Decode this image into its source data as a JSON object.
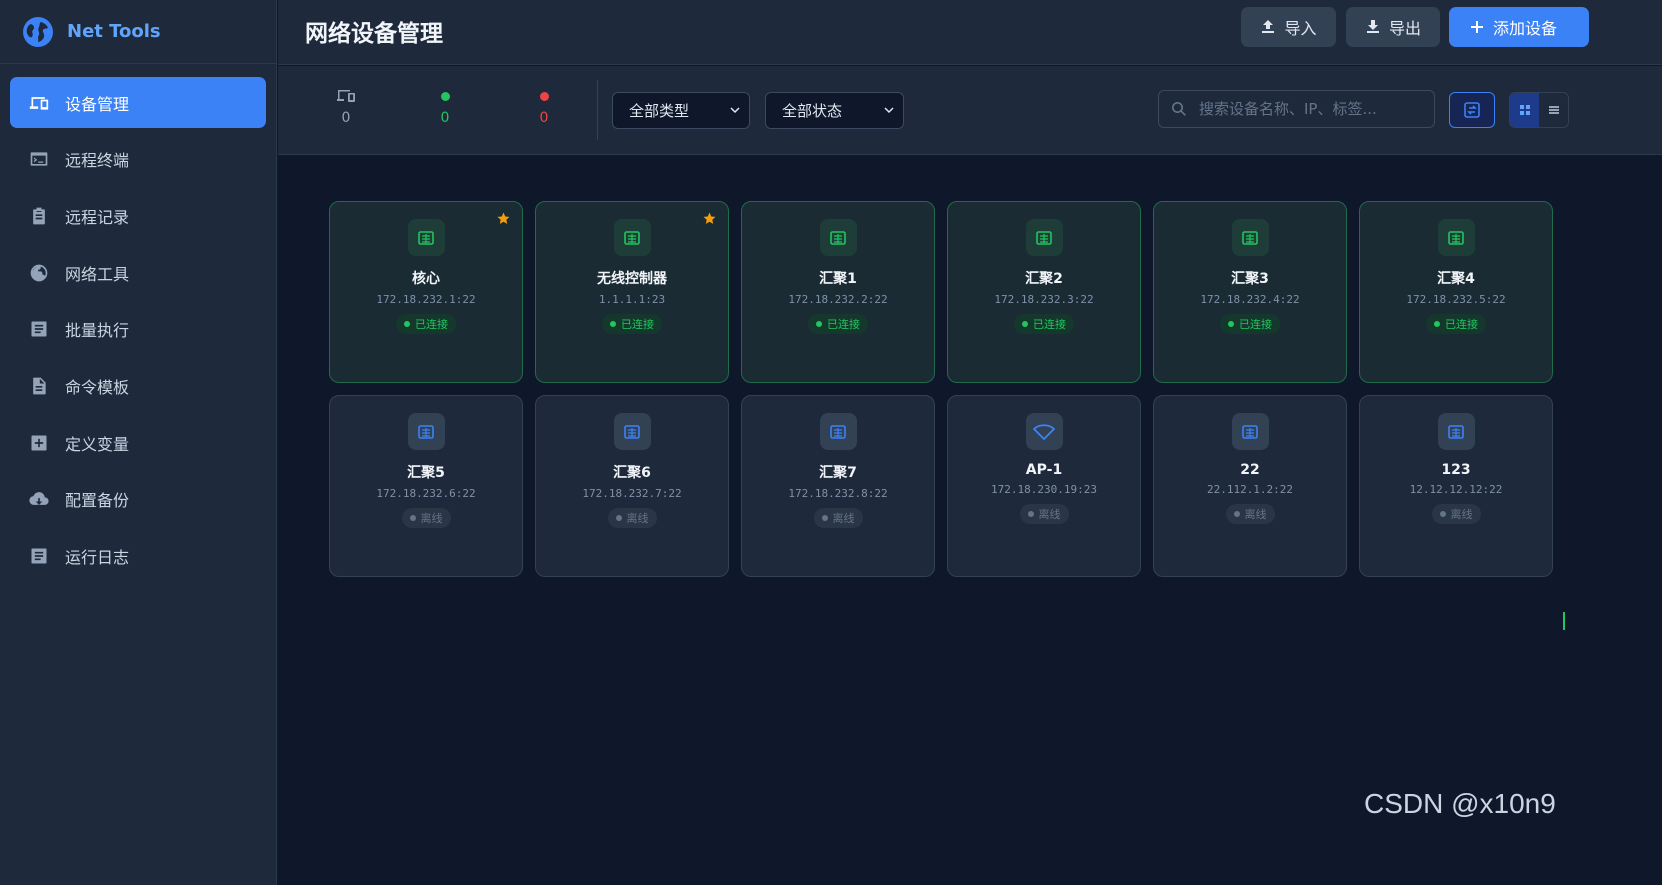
{
  "app": {
    "name": "Net Tools"
  },
  "sidebar": {
    "items": [
      {
        "label": "设备管理",
        "icon": "devices-icon",
        "active": true
      },
      {
        "label": "远程终端",
        "icon": "terminal-icon"
      },
      {
        "label": "远程记录",
        "icon": "clipboard-icon"
      },
      {
        "label": "网络工具",
        "icon": "globe-icon"
      },
      {
        "label": "批量执行",
        "icon": "document-icon"
      },
      {
        "label": "命令模板",
        "icon": "file-icon"
      },
      {
        "label": "定义变量",
        "icon": "plus-box-icon"
      },
      {
        "label": "配置备份",
        "icon": "cloud-download-icon"
      },
      {
        "label": "运行日志",
        "icon": "log-icon"
      }
    ]
  },
  "header": {
    "title": "网络设备管理",
    "import_label": "导入",
    "export_label": "导出",
    "add_label": "添加设备"
  },
  "toolbar": {
    "stats": {
      "total": "0",
      "online": "0",
      "offline": "0"
    },
    "type_filter": {
      "selected": "全部类型"
    },
    "status_filter": {
      "selected": "全部状态"
    },
    "search_placeholder": "搜索设备名称、IP、标签..."
  },
  "colors": {
    "accent": "#3b82f6",
    "online": "#22c55e",
    "offline": "#ef4444",
    "star": "#f59e0b"
  },
  "devices": [
    {
      "name": "核心",
      "address": "172.18.232.1:22",
      "status": "已连接",
      "online": true,
      "favorite": true,
      "icon": "switch-icon"
    },
    {
      "name": "无线控制器",
      "address": "1.1.1.1:23",
      "status": "已连接",
      "online": true,
      "favorite": true,
      "icon": "switch-icon"
    },
    {
      "name": "汇聚1",
      "address": "172.18.232.2:22",
      "status": "已连接",
      "online": true,
      "favorite": false,
      "icon": "switch-icon"
    },
    {
      "name": "汇聚2",
      "address": "172.18.232.3:22",
      "status": "已连接",
      "online": true,
      "favorite": false,
      "icon": "switch-icon"
    },
    {
      "name": "汇聚3",
      "address": "172.18.232.4:22",
      "status": "已连接",
      "online": true,
      "favorite": false,
      "icon": "switch-icon"
    },
    {
      "name": "汇聚4",
      "address": "172.18.232.5:22",
      "status": "已连接",
      "online": true,
      "favorite": false,
      "icon": "switch-icon"
    },
    {
      "name": "汇聚5",
      "address": "172.18.232.6:22",
      "status": "离线",
      "online": false,
      "favorite": false,
      "icon": "switch-icon"
    },
    {
      "name": "汇聚6",
      "address": "172.18.232.7:22",
      "status": "离线",
      "online": false,
      "favorite": false,
      "icon": "switch-icon"
    },
    {
      "name": "汇聚7",
      "address": "172.18.232.8:22",
      "status": "离线",
      "online": false,
      "favorite": false,
      "icon": "switch-icon"
    },
    {
      "name": "AP-1",
      "address": "172.18.230.19:23",
      "status": "离线",
      "online": false,
      "favorite": false,
      "icon": "wifi-icon"
    },
    {
      "name": "22",
      "address": "22.112.1.2:22",
      "status": "离线",
      "online": false,
      "favorite": false,
      "icon": "switch-icon"
    },
    {
      "name": "123",
      "address": "12.12.12.12:22",
      "status": "离线",
      "online": false,
      "favorite": false,
      "icon": "switch-icon"
    }
  ],
  "watermark": "CSDN @x10n9"
}
